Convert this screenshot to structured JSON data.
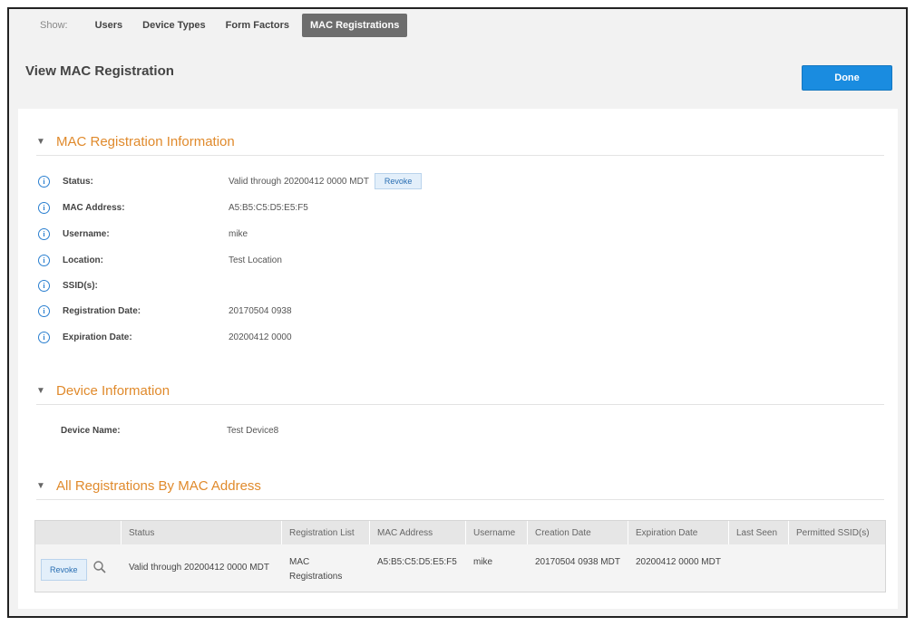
{
  "nav": {
    "show_label": "Show:",
    "tabs": [
      "Users",
      "Device Types",
      "Form Factors",
      "MAC Registrations"
    ],
    "active_tab": "MAC Registrations"
  },
  "page": {
    "title": "View MAC Registration",
    "done_label": "Done"
  },
  "mac_info": {
    "title": "MAC Registration Information",
    "revoke_label": "Revoke",
    "fields": [
      {
        "label": "Status:",
        "value": "Valid through 20200412 0000 MDT"
      },
      {
        "label": "MAC Address:",
        "value": "A5:B5:C5:D5:E5:F5"
      },
      {
        "label": "Username:",
        "value": "mike"
      },
      {
        "label": "Location:",
        "value": "Test Location"
      },
      {
        "label": "SSID(s):",
        "value": ""
      },
      {
        "label": "Registration Date:",
        "value": "20170504 0938"
      },
      {
        "label": "Expiration Date:",
        "value": "20200412 0000"
      }
    ]
  },
  "device_info": {
    "title": "Device Information",
    "device_name_label": "Device Name:",
    "device_name_value": "Test Device8"
  },
  "all_regs": {
    "title": "All Registrations By MAC Address",
    "columns": [
      "",
      "Status",
      "Registration List",
      "MAC Address",
      "Username",
      "Creation Date",
      "Expiration Date",
      "Last Seen",
      "Permitted SSID(s)"
    ],
    "rows": [
      {
        "revoke_label": "Revoke",
        "status": "Valid through 20200412 0000 MDT",
        "registration_list_line1": "MAC",
        "registration_list_line2": "Registrations",
        "mac_address": "A5:B5:C5:D5:E5:F5",
        "username": "mike",
        "creation_date": "20170504 0938 MDT",
        "expiration_date": "20200412 0000 MDT",
        "last_seen": "",
        "permitted_ssids": ""
      }
    ]
  },
  "colors": {
    "accent_blue": "#1a8ce0",
    "section_orange": "#e08a2c",
    "active_tab_bg": "#6d6d6d"
  }
}
